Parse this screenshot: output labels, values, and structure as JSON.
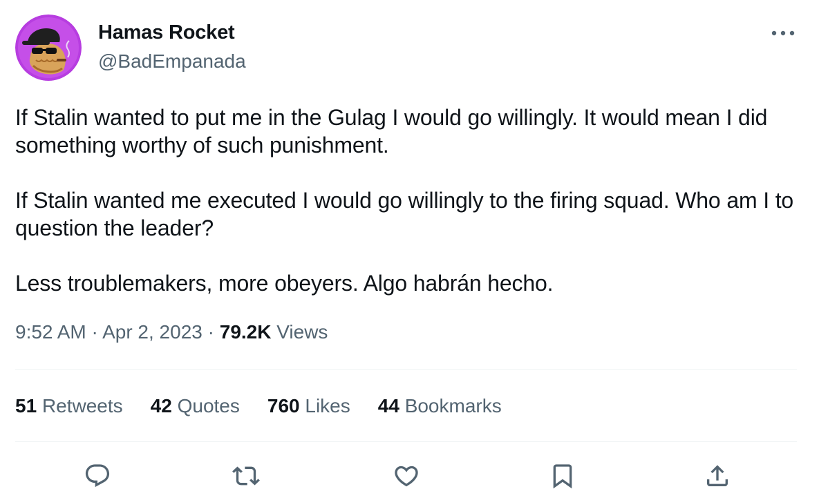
{
  "author": {
    "name": "Hamas Rocket",
    "handle": "@BadEmpanada",
    "avatar_icon": "avatar-cartoon-empanada-with-cap-and-sunglasses",
    "avatar_bg": "#b73de0"
  },
  "tweet": {
    "paragraphs": [
      "If Stalin wanted to put me in the Gulag I would go willingly. It would mean I did something worthy of such punishment.",
      "If Stalin wanted me executed I would go willingly to the firing squad. Who am I to question the leader?",
      "Less troublemakers, more obeyers. Algo habrán hecho."
    ]
  },
  "meta": {
    "time": "9:52 AM",
    "separator": "·",
    "date": "Apr 2, 2023",
    "views_count": "79.2K",
    "views_label": "Views"
  },
  "stats": {
    "retweets_count": "51",
    "retweets_label": "Retweets",
    "quotes_count": "42",
    "quotes_label": "Quotes",
    "likes_count": "760",
    "likes_label": "Likes",
    "bookmarks_count": "44",
    "bookmarks_label": "Bookmarks"
  },
  "actions": [
    "reply-icon",
    "retweet-icon",
    "like-icon",
    "bookmark-icon",
    "share-icon"
  ],
  "colors": {
    "text": "#0f1419",
    "secondary": "#536471",
    "divider": "#eff3f4"
  }
}
